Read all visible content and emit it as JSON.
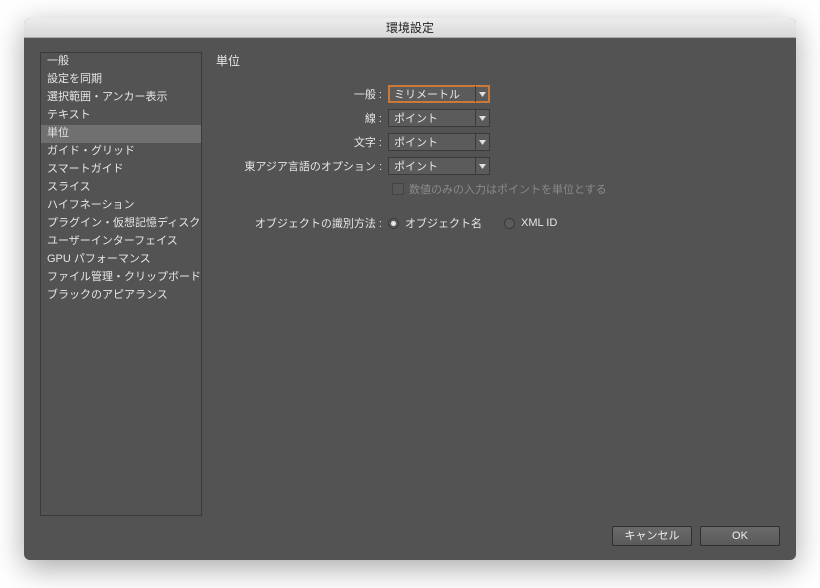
{
  "window": {
    "title": "環境設定"
  },
  "sidebar": {
    "items": [
      {
        "label": "一般"
      },
      {
        "label": "設定を同期"
      },
      {
        "label": "選択範囲・アンカー表示"
      },
      {
        "label": "テキスト"
      },
      {
        "label": "単位"
      },
      {
        "label": "ガイド・グリッド"
      },
      {
        "label": "スマートガイド"
      },
      {
        "label": "スライス"
      },
      {
        "label": "ハイフネーション"
      },
      {
        "label": "プラグイン・仮想記憶ディスク"
      },
      {
        "label": "ユーザーインターフェイス"
      },
      {
        "label": "GPU パフォーマンス"
      },
      {
        "label": "ファイル管理・クリップボード"
      },
      {
        "label": "ブラックのアピアランス"
      }
    ],
    "selected_index": 4
  },
  "panel": {
    "title": "単位",
    "rows": {
      "general": {
        "label": "一般 :",
        "value": "ミリメートル"
      },
      "stroke": {
        "label": "線 :",
        "value": "ポイント"
      },
      "type": {
        "label": "文字 :",
        "value": "ポイント"
      },
      "asian": {
        "label": "東アジア言語のオプション :",
        "value": "ポイント"
      }
    },
    "numeric_only": {
      "label": "数値のみの入力はポイントを単位とする"
    },
    "identify": {
      "label": "オブジェクトの識別方法 :",
      "opt1": "オブジェクト名",
      "opt2": "XML ID"
    }
  },
  "buttons": {
    "cancel": "キャンセル",
    "ok": "OK"
  }
}
